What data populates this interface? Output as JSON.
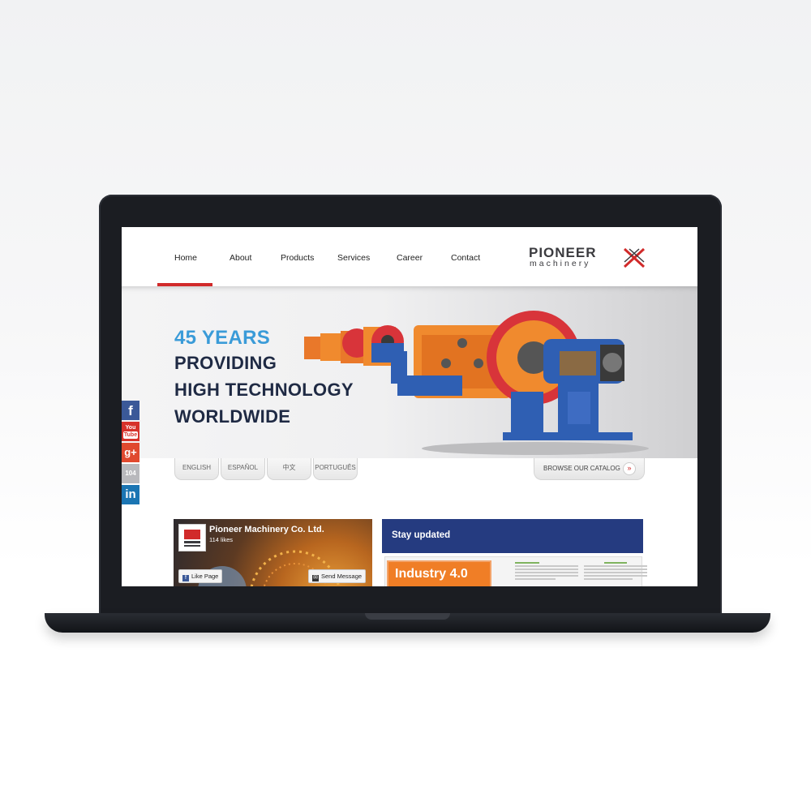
{
  "nav": {
    "items": [
      "Home",
      "About",
      "Products",
      "Services",
      "Career",
      "Contact"
    ],
    "active": "Home",
    "accent_color": "#d12a2a"
  },
  "logo": {
    "top": "PIONEER",
    "bottom": "machinery"
  },
  "hero": {
    "accent": "45 YEARS",
    "line1": "PROVIDING",
    "line2": "HIGH TECHNOLOGY",
    "line3": "WORLDWIDE",
    "accent_color": "#3a9bd8",
    "text_color": "#1f2a44"
  },
  "languages": [
    "ENGLISH",
    "ESPAÑOL",
    "中文",
    "PORTUGUÊS"
  ],
  "catalog": {
    "label": "BROWSE OUR CATALOG",
    "icon": "chevron-double-down-icon"
  },
  "social": {
    "facebook": "f",
    "youtube_top": "You",
    "youtube_bottom": "Tube",
    "google_plus": "g+",
    "n104": "104",
    "linkedin": "in"
  },
  "facebook_widget": {
    "page_name": "Pioneer Machinery Co. Ltd.",
    "likes": "114 likes",
    "like_button": "Like Page",
    "message_button": "Send Message"
  },
  "newsletter": {
    "heading": "Stay updated",
    "feature": "Industry 4.0",
    "header_color": "#253b80",
    "feature_color": "#f07e26"
  }
}
